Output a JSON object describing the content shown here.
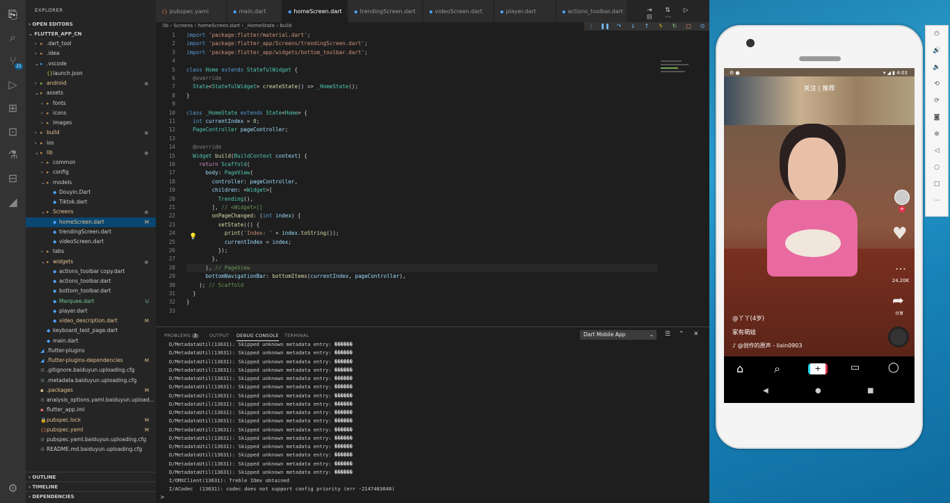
{
  "activity": {
    "icons": [
      "files-icon",
      "search-icon",
      "source-control-icon",
      "run-debug-icon",
      "extensions-icon",
      "remote-icon",
      "test-icon",
      "docker-icon",
      "flutter-icon"
    ],
    "scm_badge": "21"
  },
  "sidebar": {
    "title": "EXPLORER",
    "open_editors": "OPEN EDITORS",
    "project": "FLUTTER_APP_CN",
    "outline": "OUTLINE",
    "timeline": "TIMELINE",
    "dependencies": "DEPENDENCIES",
    "items": [
      {
        "label": ".dart_tool",
        "indent": 1,
        "chev": "›",
        "icon": "folder"
      },
      {
        "label": ".idea",
        "indent": 1,
        "chev": "›",
        "icon": "folder"
      },
      {
        "label": ".vscode",
        "indent": 1,
        "chev": "⌄",
        "icon": "folder-vscode"
      },
      {
        "label": "launch.json",
        "indent": 2,
        "chev": "",
        "icon": "json"
      },
      {
        "label": "android",
        "indent": 1,
        "chev": "›",
        "icon": "folder-android",
        "color": "#e2c08d",
        "dot": true
      },
      {
        "label": "assets",
        "indent": 1,
        "chev": "⌄",
        "icon": "folder"
      },
      {
        "label": "fonts",
        "indent": 2,
        "chev": "›",
        "icon": "folder"
      },
      {
        "label": "icons",
        "indent": 2,
        "chev": "›",
        "icon": "folder"
      },
      {
        "label": "images",
        "indent": 2,
        "chev": "›",
        "icon": "folder"
      },
      {
        "label": "build",
        "indent": 1,
        "chev": "›",
        "icon": "folder",
        "color": "#e2c08d",
        "dot": true
      },
      {
        "label": "ios",
        "indent": 1,
        "chev": "›",
        "icon": "folder"
      },
      {
        "label": "lib",
        "indent": 1,
        "chev": "⌄",
        "icon": "folder",
        "color": "#e2c08d",
        "dot": true
      },
      {
        "label": "common",
        "indent": 2,
        "chev": "›",
        "icon": "folder"
      },
      {
        "label": "config",
        "indent": 2,
        "chev": "›",
        "icon": "folder"
      },
      {
        "label": "models",
        "indent": 2,
        "chev": "⌄",
        "icon": "folder"
      },
      {
        "label": "Douyin.Dart",
        "indent": 3,
        "chev": "",
        "icon": "dart"
      },
      {
        "label": "Tiktok.dart",
        "indent": 3,
        "chev": "",
        "icon": "dart"
      },
      {
        "label": "Screens",
        "indent": 2,
        "chev": "⌄",
        "icon": "folder",
        "color": "#e2c08d",
        "dot": true
      },
      {
        "label": "homeScreen.dart",
        "indent": 3,
        "chev": "",
        "icon": "dart",
        "color": "#e2c08d",
        "status": "M",
        "selected": true
      },
      {
        "label": "trendingScreen.dart",
        "indent": 3,
        "chev": "",
        "icon": "dart"
      },
      {
        "label": "videoScreen.dart",
        "indent": 3,
        "chev": "",
        "icon": "dart"
      },
      {
        "label": "tabs",
        "indent": 2,
        "chev": "›",
        "icon": "folder"
      },
      {
        "label": "widgets",
        "indent": 2,
        "chev": "⌄",
        "icon": "folder",
        "color": "#e2c08d",
        "dot": true
      },
      {
        "label": "actions_toolbar copy.dart",
        "indent": 3,
        "chev": "",
        "icon": "dart"
      },
      {
        "label": "actions_toolbar.dart",
        "indent": 3,
        "chev": "",
        "icon": "dart"
      },
      {
        "label": "bottom_toolbar.dart",
        "indent": 3,
        "chev": "",
        "icon": "dart"
      },
      {
        "label": "Marquee.dart",
        "indent": 3,
        "chev": "",
        "icon": "dart",
        "color": "#73c991",
        "status": "U"
      },
      {
        "label": "player.dart",
        "indent": 3,
        "chev": "",
        "icon": "dart"
      },
      {
        "label": "video_description.dart",
        "indent": 3,
        "chev": "",
        "icon": "dart",
        "color": "#e2c08d",
        "status": "M"
      },
      {
        "label": "keyboard_test_page.dart",
        "indent": 2,
        "chev": "",
        "icon": "dart"
      },
      {
        "label": "main.dart",
        "indent": 2,
        "chev": "",
        "icon": "dart"
      },
      {
        "label": ".flutter-plugins",
        "indent": 1,
        "chev": "",
        "icon": "flutter"
      },
      {
        "label": ".flutter-plugins-dependencies",
        "indent": 1,
        "chev": "",
        "icon": "flutter",
        "color": "#e2c08d",
        "status": "M"
      },
      {
        "label": ".gitignore.baiduyun.uploading.cfg",
        "indent": 1,
        "chev": "",
        "icon": "cfg"
      },
      {
        "label": ".metadata.baiduyun.uploading.cfg",
        "indent": 1,
        "chev": "",
        "icon": "cfg"
      },
      {
        "label": ".packages",
        "indent": 1,
        "chev": "",
        "icon": "pkg",
        "color": "#e2c08d",
        "status": "M"
      },
      {
        "label": "analysis_options.yaml.baiduyun.upload...",
        "indent": 1,
        "chev": "",
        "icon": "cfg"
      },
      {
        "label": "flutter_app.iml",
        "indent": 1,
        "chev": "",
        "icon": "iml"
      },
      {
        "label": "pubspec.lock",
        "indent": 1,
        "chev": "",
        "icon": "lock",
        "color": "#e2c08d",
        "status": "M"
      },
      {
        "label": "pubspec.yaml",
        "indent": 1,
        "chev": "",
        "icon": "yaml",
        "color": "#e2c08d",
        "status": "M"
      },
      {
        "label": "pubspec.yaml.baiduyun.uploading.cfg",
        "indent": 1,
        "chev": "",
        "icon": "cfg"
      },
      {
        "label": "README.md.baiduyun.uploading.cfg",
        "indent": 1,
        "chev": "",
        "icon": "cfg"
      }
    ]
  },
  "tabs": [
    {
      "label": "pubspec.yaml",
      "icon": "{}",
      "active": false
    },
    {
      "label": "main.dart",
      "icon": "◆",
      "active": false
    },
    {
      "label": "homeScreen.dart",
      "icon": "◆",
      "active": true
    },
    {
      "label": "trendingScreen.dart",
      "icon": "◆",
      "active": false
    },
    {
      "label": "videoScreen.dart",
      "icon": "◆",
      "active": false
    },
    {
      "label": "player.dart",
      "icon": "◆",
      "active": false
    },
    {
      "label": "actions_toolbar.dart",
      "icon": "◆",
      "active": false
    }
  ],
  "breadcrumb": "lib › Screens › homeScreen.dart › _HomeState › build",
  "code": [
    [
      [
        "kw",
        "import "
      ],
      [
        "st2",
        "'package:flutter/material.dart'"
      ],
      [
        "",
        "; "
      ]
    ],
    [
      [
        "kw",
        "import "
      ],
      [
        "st2",
        "'package:flutter_app/Screens/trendingScreen.dart'"
      ],
      [
        "",
        ";"
      ]
    ],
    [
      [
        "kw",
        "import "
      ],
      [
        "st2",
        "'package:flutter_app/widgets/bottom_toolbar.dart'"
      ],
      [
        "",
        ";"
      ]
    ],
    [],
    [
      [
        "kw",
        "class "
      ],
      [
        "ty",
        "Home "
      ],
      [
        "kw",
        "extends "
      ],
      [
        "ty",
        "StatefulWidget "
      ],
      [
        "",
        "{"
      ]
    ],
    [
      [
        "",
        "  "
      ],
      [
        "an",
        "@override"
      ]
    ],
    [
      [
        "",
        "  "
      ],
      [
        "ty",
        "State"
      ],
      [
        "",
        "<"
      ],
      [
        "ty",
        "StatefulWidget"
      ],
      [
        "",
        "> "
      ],
      [
        "fn",
        "createState"
      ],
      [
        "",
        "() => "
      ],
      [
        "ty",
        "_HomeState"
      ],
      [
        "",
        "();"
      ]
    ],
    [
      [
        "",
        "}"
      ]
    ],
    [],
    [
      [
        "kw",
        "class "
      ],
      [
        "ty",
        "_HomeState "
      ],
      [
        "kw",
        "extends "
      ],
      [
        "ty",
        "State"
      ],
      [
        "",
        "<"
      ],
      [
        "ty",
        "Home"
      ],
      [
        "",
        "> {"
      ]
    ],
    [
      [
        "",
        "  "
      ],
      [
        "kw",
        "int "
      ],
      [
        "vr",
        "currentIndex"
      ],
      [
        "",
        " = "
      ],
      [
        "num",
        "0"
      ],
      [
        "",
        ";"
      ]
    ],
    [
      [
        "",
        "  "
      ],
      [
        "ty",
        "PageController "
      ],
      [
        "vr",
        "pageController"
      ],
      [
        "",
        ";"
      ]
    ],
    [],
    [
      [
        "",
        "  "
      ],
      [
        "an",
        "@override"
      ]
    ],
    [
      [
        "",
        "  "
      ],
      [
        "ty",
        "Widget "
      ],
      [
        "fn",
        "build"
      ],
      [
        "",
        "("
      ],
      [
        "ty",
        "BuildContext "
      ],
      [
        "vr",
        "context"
      ],
      [
        "",
        ") {"
      ]
    ],
    [
      [
        "",
        "    "
      ],
      [
        "ctl",
        "return "
      ],
      [
        "ty",
        "Scaffold"
      ],
      [
        "",
        "("
      ]
    ],
    [
      [
        "",
        "      "
      ],
      [
        "vr",
        "body"
      ],
      [
        ": "
      ],
      [
        "ty",
        "PageView"
      ],
      [
        "",
        "("
      ]
    ],
    [
      [
        "",
        "        "
      ],
      [
        "vr",
        "controller"
      ],
      [
        "",
        ": "
      ],
      [
        "vr",
        "pageController"
      ],
      [
        "",
        ","
      ]
    ],
    [
      [
        "",
        "        "
      ],
      [
        "vr",
        "children"
      ],
      [
        "",
        ": <"
      ],
      [
        "ty",
        "Widget"
      ],
      [
        "",
        ">["
      ]
    ],
    [
      [
        "",
        "          "
      ],
      [
        "ty",
        "Trending"
      ],
      [
        "",
        "(),"
      ]
    ],
    [
      [
        "",
        "        ], "
      ],
      [
        "cm",
        "// <Widget>[]"
      ]
    ],
    [
      [
        "",
        "        "
      ],
      [
        "fn",
        "onPageChanged"
      ],
      [
        "",
        ": ("
      ],
      [
        "kw",
        "int "
      ],
      [
        "vr",
        "index"
      ],
      [
        "",
        ") {"
      ]
    ],
    [
      [
        "",
        "          "
      ],
      [
        "fn",
        "setState"
      ],
      [
        "",
        "(() {"
      ]
    ],
    [
      [
        "",
        "            "
      ],
      [
        "fn",
        "print"
      ],
      [
        "",
        "("
      ],
      [
        "st2",
        "'Index: '"
      ],
      [
        "",
        " + "
      ],
      [
        "vr",
        "index"
      ],
      [
        "",
        "."
      ],
      [
        "fn",
        "toString"
      ],
      [
        "",
        "());"
      ]
    ],
    [
      [
        "",
        "            "
      ],
      [
        "vr",
        "currentIndex"
      ],
      [
        "",
        " = "
      ],
      [
        "vr",
        "index"
      ],
      [
        "",
        ";"
      ]
    ],
    [
      [
        "",
        "          });"
      ]
    ],
    [
      [
        "",
        "        },"
      ]
    ],
    [
      [
        "",
        "      ), "
      ],
      [
        "cm",
        "// PageView"
      ]
    ],
    [
      [
        "",
        "      "
      ],
      [
        "vr",
        "bottomNavigationBar"
      ],
      [
        "",
        ": "
      ],
      [
        "fn",
        "bottomItems"
      ],
      [
        "",
        "("
      ],
      [
        "vr",
        "currentIndex"
      ],
      [
        "",
        ", "
      ],
      [
        "vr",
        "pageController"
      ],
      [
        "",
        "),"
      ]
    ],
    [
      [
        "",
        "    ); "
      ],
      [
        "cm",
        "// Scaffold"
      ]
    ],
    [
      [
        "",
        "  }"
      ]
    ],
    [
      [
        "",
        "}"
      ]
    ],
    []
  ],
  "panel": {
    "tabs": [
      "PROBLEMS",
      "OUTPUT",
      "DEBUG CONSOLE",
      "TERMINAL"
    ],
    "problems_count": "3",
    "select": "Dart Mobile App",
    "prompt": ">",
    "lines": [
      "D/MetadataUtil(13631): Skipped unknown metadata entry: ������",
      "D/MetadataUtil(13631): Skipped unknown metadata entry: ������",
      "D/MetadataUtil(13631): Skipped unknown metadata entry: ������",
      "D/MetadataUtil(13631): Skipped unknown metadata entry: ������",
      "D/MetadataUtil(13631): Skipped unknown metadata entry: ������",
      "D/MetadataUtil(13631): Skipped unknown metadata entry: ������",
      "D/MetadataUtil(13631): Skipped unknown metadata entry: ������",
      "D/MetadataUtil(13631): Skipped unknown metadata entry: ������",
      "D/MetadataUtil(13631): Skipped unknown metadata entry: ������",
      "D/MetadataUtil(13631): Skipped unknown metadata entry: ������",
      "D/MetadataUtil(13631): Skipped unknown metadata entry: ������",
      "D/MetadataUtil(13631): Skipped unknown metadata entry: ������",
      "D/MetadataUtil(13631): Skipped unknown metadata entry: ������",
      "D/MetadataUtil(13631): Skipped unknown metadata entry: ������",
      "D/MetadataUtil(13631): Skipped unknown metadata entry: ������",
      "D/MetadataUtil(13631): Skipped unknown metadata entry: ������",
      "I/OMXClient(13631): Treble IOmx obtained",
      "I/ACodec  (13631): codec does not support config priority (err -2147483648)"
    ]
  },
  "phone": {
    "time": "4:03",
    "top_tabs": "关注 | 推荐",
    "likes": "24.20K",
    "share": "分享",
    "username": "@丫丫(4岁)",
    "desc": "家有萌娃",
    "music": "♪ @创作的原声 - lixin0903"
  }
}
